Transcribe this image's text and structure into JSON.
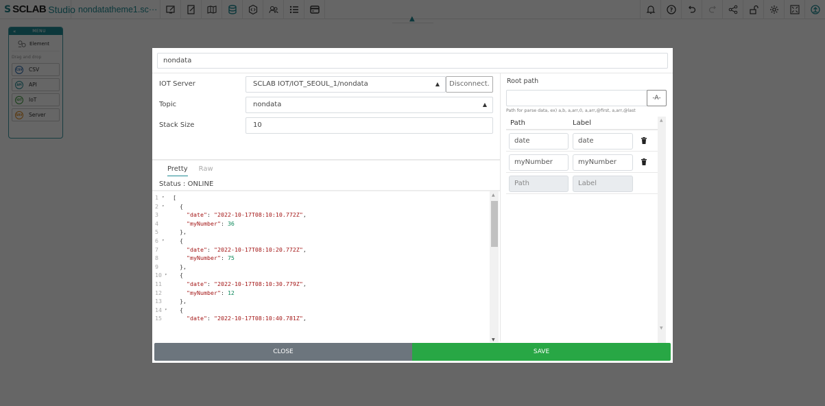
{
  "app": {
    "brand_sclab": "SCLAB",
    "brand_studio": "Studio",
    "filename": "nondatatheme1.sc···"
  },
  "toolbar": {
    "left_tools": [
      "edit-screen-icon",
      "edit-page-icon",
      "map-icon",
      "database-icon",
      "code-icon",
      "users-icon",
      "list-icon",
      "card-icon"
    ],
    "right_tools": [
      "bell-icon",
      "help-icon",
      "undo-icon",
      "redo-icon",
      "share-icon",
      "unlock-icon",
      "gear-icon",
      "fullscreen-icon",
      "upload-icon"
    ],
    "active_tool": "database-icon",
    "accent": "#1f8a93"
  },
  "sidemenu": {
    "back": "«",
    "title": "MENU",
    "element_label": "Element",
    "dnd_label": "Drag and drop",
    "items": [
      {
        "label": "CSV",
        "badge": "CSV",
        "color": "#2a6ab0"
      },
      {
        "label": "API",
        "badge": "API",
        "color": "#1f8a93"
      },
      {
        "label": "IoT",
        "badge": "IOT",
        "color": "#3a9a3a"
      },
      {
        "label": "Server",
        "badge": "SRV",
        "color": "#e08a1e"
      }
    ]
  },
  "modal": {
    "name_value": "nondata",
    "form": {
      "iot_server_label": "IOT Server",
      "iot_server_value": "SCLAB IOT/IOT_SEOUL_1/nondata",
      "disconnect_label": "Disconnect.",
      "topic_label": "Topic",
      "topic_value": "nondata",
      "stack_size_label": "Stack Size",
      "stack_size_value": "10"
    },
    "tabs": {
      "pretty": "Pretty",
      "raw": "Raw",
      "active": "Pretty"
    },
    "status": "Status : ONLINE",
    "code_lines": [
      {
        "n": "1",
        "fold": true,
        "parts": [
          {
            "t": "p",
            "v": "["
          }
        ]
      },
      {
        "n": "2",
        "fold": true,
        "parts": [
          {
            "t": "p",
            "v": "  {"
          }
        ]
      },
      {
        "n": "3",
        "fold": false,
        "parts": [
          {
            "t": "p",
            "v": "    "
          },
          {
            "t": "k",
            "v": "\"date\""
          },
          {
            "t": "p",
            "v": ": "
          },
          {
            "t": "s",
            "v": "\"2022-10-17T08:10:10.772Z\""
          },
          {
            "t": "p",
            "v": ","
          }
        ]
      },
      {
        "n": "4",
        "fold": false,
        "parts": [
          {
            "t": "p",
            "v": "    "
          },
          {
            "t": "k",
            "v": "\"myNumber\""
          },
          {
            "t": "p",
            "v": ": "
          },
          {
            "t": "n",
            "v": "36"
          }
        ]
      },
      {
        "n": "5",
        "fold": false,
        "parts": [
          {
            "t": "p",
            "v": "  },"
          }
        ]
      },
      {
        "n": "6",
        "fold": true,
        "parts": [
          {
            "t": "p",
            "v": "  {"
          }
        ]
      },
      {
        "n": "7",
        "fold": false,
        "parts": [
          {
            "t": "p",
            "v": "    "
          },
          {
            "t": "k",
            "v": "\"date\""
          },
          {
            "t": "p",
            "v": ": "
          },
          {
            "t": "s",
            "v": "\"2022-10-17T08:10:20.772Z\""
          },
          {
            "t": "p",
            "v": ","
          }
        ]
      },
      {
        "n": "8",
        "fold": false,
        "parts": [
          {
            "t": "p",
            "v": "    "
          },
          {
            "t": "k",
            "v": "\"myNumber\""
          },
          {
            "t": "p",
            "v": ": "
          },
          {
            "t": "n",
            "v": "75"
          }
        ]
      },
      {
        "n": "9",
        "fold": false,
        "parts": [
          {
            "t": "p",
            "v": "  },"
          }
        ]
      },
      {
        "n": "10",
        "fold": true,
        "parts": [
          {
            "t": "p",
            "v": "  {"
          }
        ]
      },
      {
        "n": "11",
        "fold": false,
        "parts": [
          {
            "t": "p",
            "v": "    "
          },
          {
            "t": "k",
            "v": "\"date\""
          },
          {
            "t": "p",
            "v": ": "
          },
          {
            "t": "s",
            "v": "\"2022-10-17T08:10:30.779Z\""
          },
          {
            "t": "p",
            "v": ","
          }
        ]
      },
      {
        "n": "12",
        "fold": false,
        "parts": [
          {
            "t": "p",
            "v": "    "
          },
          {
            "t": "k",
            "v": "\"myNumber\""
          },
          {
            "t": "p",
            "v": ": "
          },
          {
            "t": "n",
            "v": "12"
          }
        ]
      },
      {
        "n": "13",
        "fold": false,
        "parts": [
          {
            "t": "p",
            "v": "  },"
          }
        ]
      },
      {
        "n": "14",
        "fold": true,
        "parts": [
          {
            "t": "p",
            "v": "  {"
          }
        ]
      },
      {
        "n": "15",
        "fold": false,
        "parts": [
          {
            "t": "p",
            "v": "    "
          },
          {
            "t": "k",
            "v": "\"date\""
          },
          {
            "t": "p",
            "v": ": "
          },
          {
            "t": "s",
            "v": "\"2022-10-17T08:10:40.781Z\""
          },
          {
            "t": "p",
            "v": ","
          }
        ]
      }
    ],
    "editor_scroll_fraction": 0.0,
    "right": {
      "root_path_label": "Root path",
      "root_path_value": "",
      "root_path_button": "-A-",
      "hint": "Path for parse data, ex) a,b, a,arr,0, a,arr,@first, a,arr,@last",
      "col_path": "Path",
      "col_label": "Label",
      "rows": [
        {
          "path": "date",
          "label": "date"
        },
        {
          "path": "myNumber",
          "label": "myNumber"
        }
      ],
      "new_row": {
        "path_placeholder": "Path",
        "label_placeholder": "Label"
      }
    },
    "close_label": "CLOSE",
    "save_label": "SAVE"
  }
}
